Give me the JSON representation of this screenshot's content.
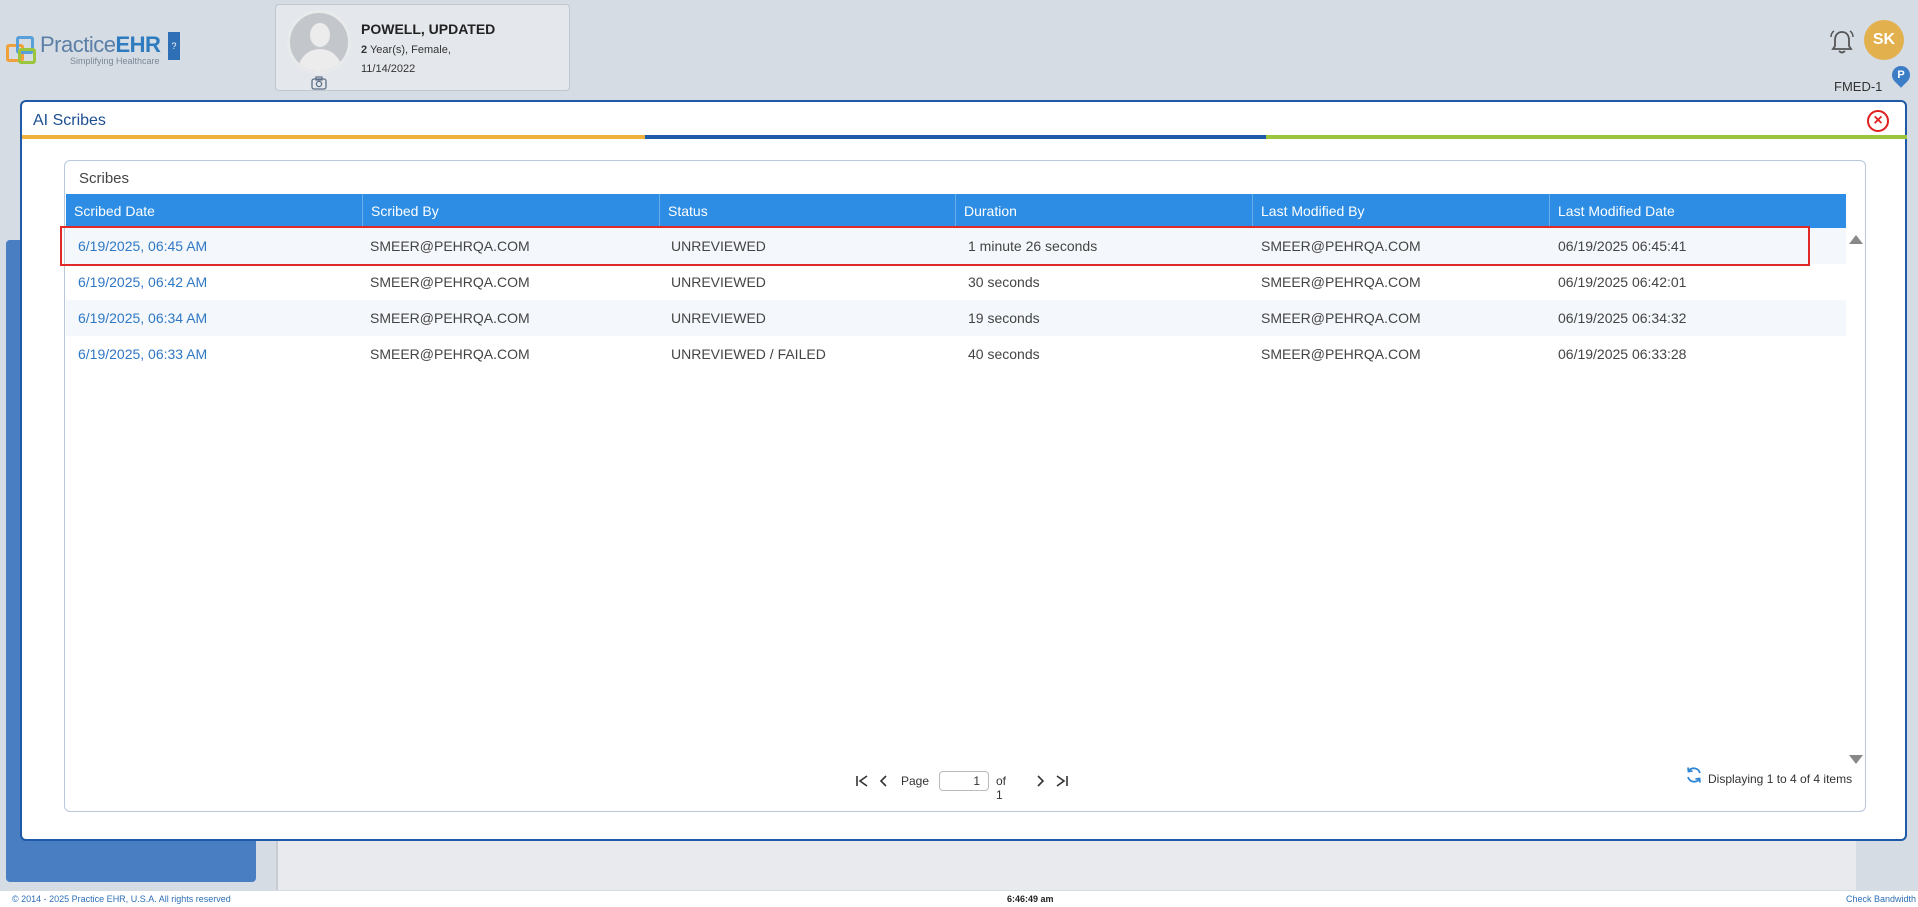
{
  "brand": {
    "name_light": "Practice",
    "name_bold": "EHR",
    "tagline": "Simplifying Healthcare",
    "badge": "?"
  },
  "patient": {
    "name": "POWELL, UPDATED",
    "age_num": "2",
    "age_rest": " Year(s), Female,",
    "dob": "11/14/2022"
  },
  "header": {
    "user_initials": "SK",
    "location": "FMED-1",
    "location_pin": "P"
  },
  "modal": {
    "title": "AI Scribes",
    "close_icon": "×",
    "stripe_colors": [
      "#f0b03c",
      "#1e5aa8",
      "#9bc53d"
    ]
  },
  "panel": {
    "title": "Scribes",
    "columns": [
      "Scribed Date",
      "Scribed By",
      "Status",
      "Duration",
      "Last Modified By",
      "Last Modified Date"
    ],
    "rows": [
      {
        "scribed_date": "6/19/2025, 06:45 AM",
        "scribed_by": "SMEER@PEHRQA.COM",
        "status": "UNREVIEWED",
        "duration": "1 minute 26 seconds",
        "modified_by": "SMEER@PEHRQA.COM",
        "modified_date": "06/19/2025 06:45:41"
      },
      {
        "scribed_date": "6/19/2025, 06:42 AM",
        "scribed_by": "SMEER@PEHRQA.COM",
        "status": "UNREVIEWED",
        "duration": "30 seconds",
        "modified_by": "SMEER@PEHRQA.COM",
        "modified_date": "06/19/2025 06:42:01"
      },
      {
        "scribed_date": "6/19/2025, 06:34 AM",
        "scribed_by": "SMEER@PEHRQA.COM",
        "status": "UNREVIEWED",
        "duration": "19 seconds",
        "modified_by": "SMEER@PEHRQA.COM",
        "modified_date": "06/19/2025 06:34:32"
      },
      {
        "scribed_date": "6/19/2025, 06:33 AM",
        "scribed_by": "SMEER@PEHRQA.COM",
        "status": "UNREVIEWED / FAILED",
        "duration": "40 seconds",
        "modified_by": "SMEER@PEHRQA.COM",
        "modified_date": "06/19/2025 06:33:28"
      }
    ]
  },
  "pager": {
    "page_label": "Page",
    "page_value": "1",
    "of_label": "of 1",
    "display_info": "Displaying 1 to 4 of 4 items"
  },
  "footer": {
    "copyright": "© 2014 - 2025 Practice EHR, U.S.A. All rights reserved",
    "clock": "6:46:49 am",
    "bandwidth": "Check Bandwidth"
  }
}
